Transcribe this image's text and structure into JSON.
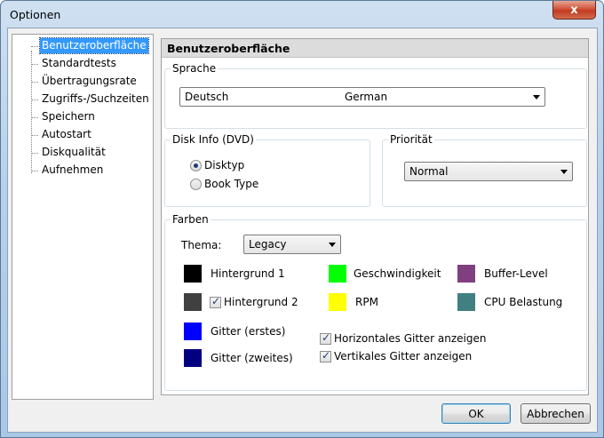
{
  "window": {
    "title": "Optionen",
    "close_glyph": "x"
  },
  "tree": {
    "items": [
      {
        "label": "Benutzeroberfläche",
        "selected": true
      },
      {
        "label": "Standardtests"
      },
      {
        "label": "Übertragungsrate"
      },
      {
        "label": "Zugriffs-/Suchzeiten"
      },
      {
        "label": "Speichern"
      },
      {
        "label": "Autostart"
      },
      {
        "label": "Diskqualität"
      },
      {
        "label": "Aufnehmen"
      }
    ]
  },
  "panel": {
    "header": "Benutzeroberfläche",
    "language": {
      "legend": "Sprache",
      "value": "Deutsch",
      "value_english": "German"
    },
    "disk_info": {
      "legend": "Disk Info (DVD)",
      "options": [
        {
          "label": "Disktyp",
          "checked": true
        },
        {
          "label": "Book Type",
          "checked": false
        }
      ]
    },
    "priority": {
      "legend": "Priorität",
      "value": "Normal"
    },
    "colors": {
      "legend": "Farben",
      "theme_label": "Thema:",
      "theme_value": "Legacy",
      "items": [
        {
          "label": "Hintergrund 1",
          "color": "#000000"
        },
        {
          "label": "Hintergrund 2",
          "color": "#404040",
          "checkbox": true,
          "checked": true
        },
        {
          "label": "Gitter (erstes)",
          "color": "#0000ff"
        },
        {
          "label": "Gitter (zweites)",
          "color": "#000080"
        },
        {
          "label": "Geschwindigkeit",
          "color": "#00ff00"
        },
        {
          "label": "RPM",
          "color": "#ffff00"
        },
        {
          "label": "Buffer-Level",
          "color": "#804080"
        },
        {
          "label": "CPU Belastung",
          "color": "#408080"
        }
      ],
      "checkboxes": [
        {
          "label": "Horizontales Gitter anzeigen",
          "checked": true
        },
        {
          "label": "Vertikales Gitter anzeigen",
          "checked": true
        }
      ]
    }
  },
  "buttons": {
    "ok": "OK",
    "cancel": "Abbrechen"
  }
}
